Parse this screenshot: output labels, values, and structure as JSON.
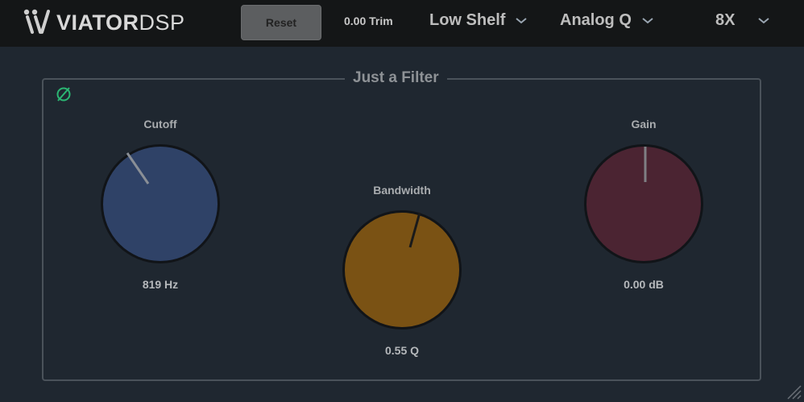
{
  "brand": {
    "name_bold": "VIATOR",
    "name_light": "DSP"
  },
  "toolbar": {
    "reset_label": "Reset",
    "trim_label": "0.00 Trim",
    "filter_type": "Low Shelf",
    "q_type": "Analog Q",
    "oversampling": "8X"
  },
  "panel": {
    "title": "Just a Filter"
  },
  "knobs": {
    "cutoff": {
      "label": "Cutoff",
      "value": "819 Hz",
      "color": "#2f4267"
    },
    "bandwidth": {
      "label": "Bandwidth",
      "value": "0.55 Q",
      "color": "#7a5214"
    },
    "gain": {
      "label": "Gain",
      "value": "0.00 dB",
      "color": "#4b2432"
    }
  },
  "colors": {
    "accent_green": "#2bb673",
    "background": "#1f2730",
    "topbar": "#141617"
  },
  "icons": {
    "phase": "phase-invert-icon",
    "chevron": "chevron-down-icon",
    "resize": "resize-grip-icon"
  }
}
